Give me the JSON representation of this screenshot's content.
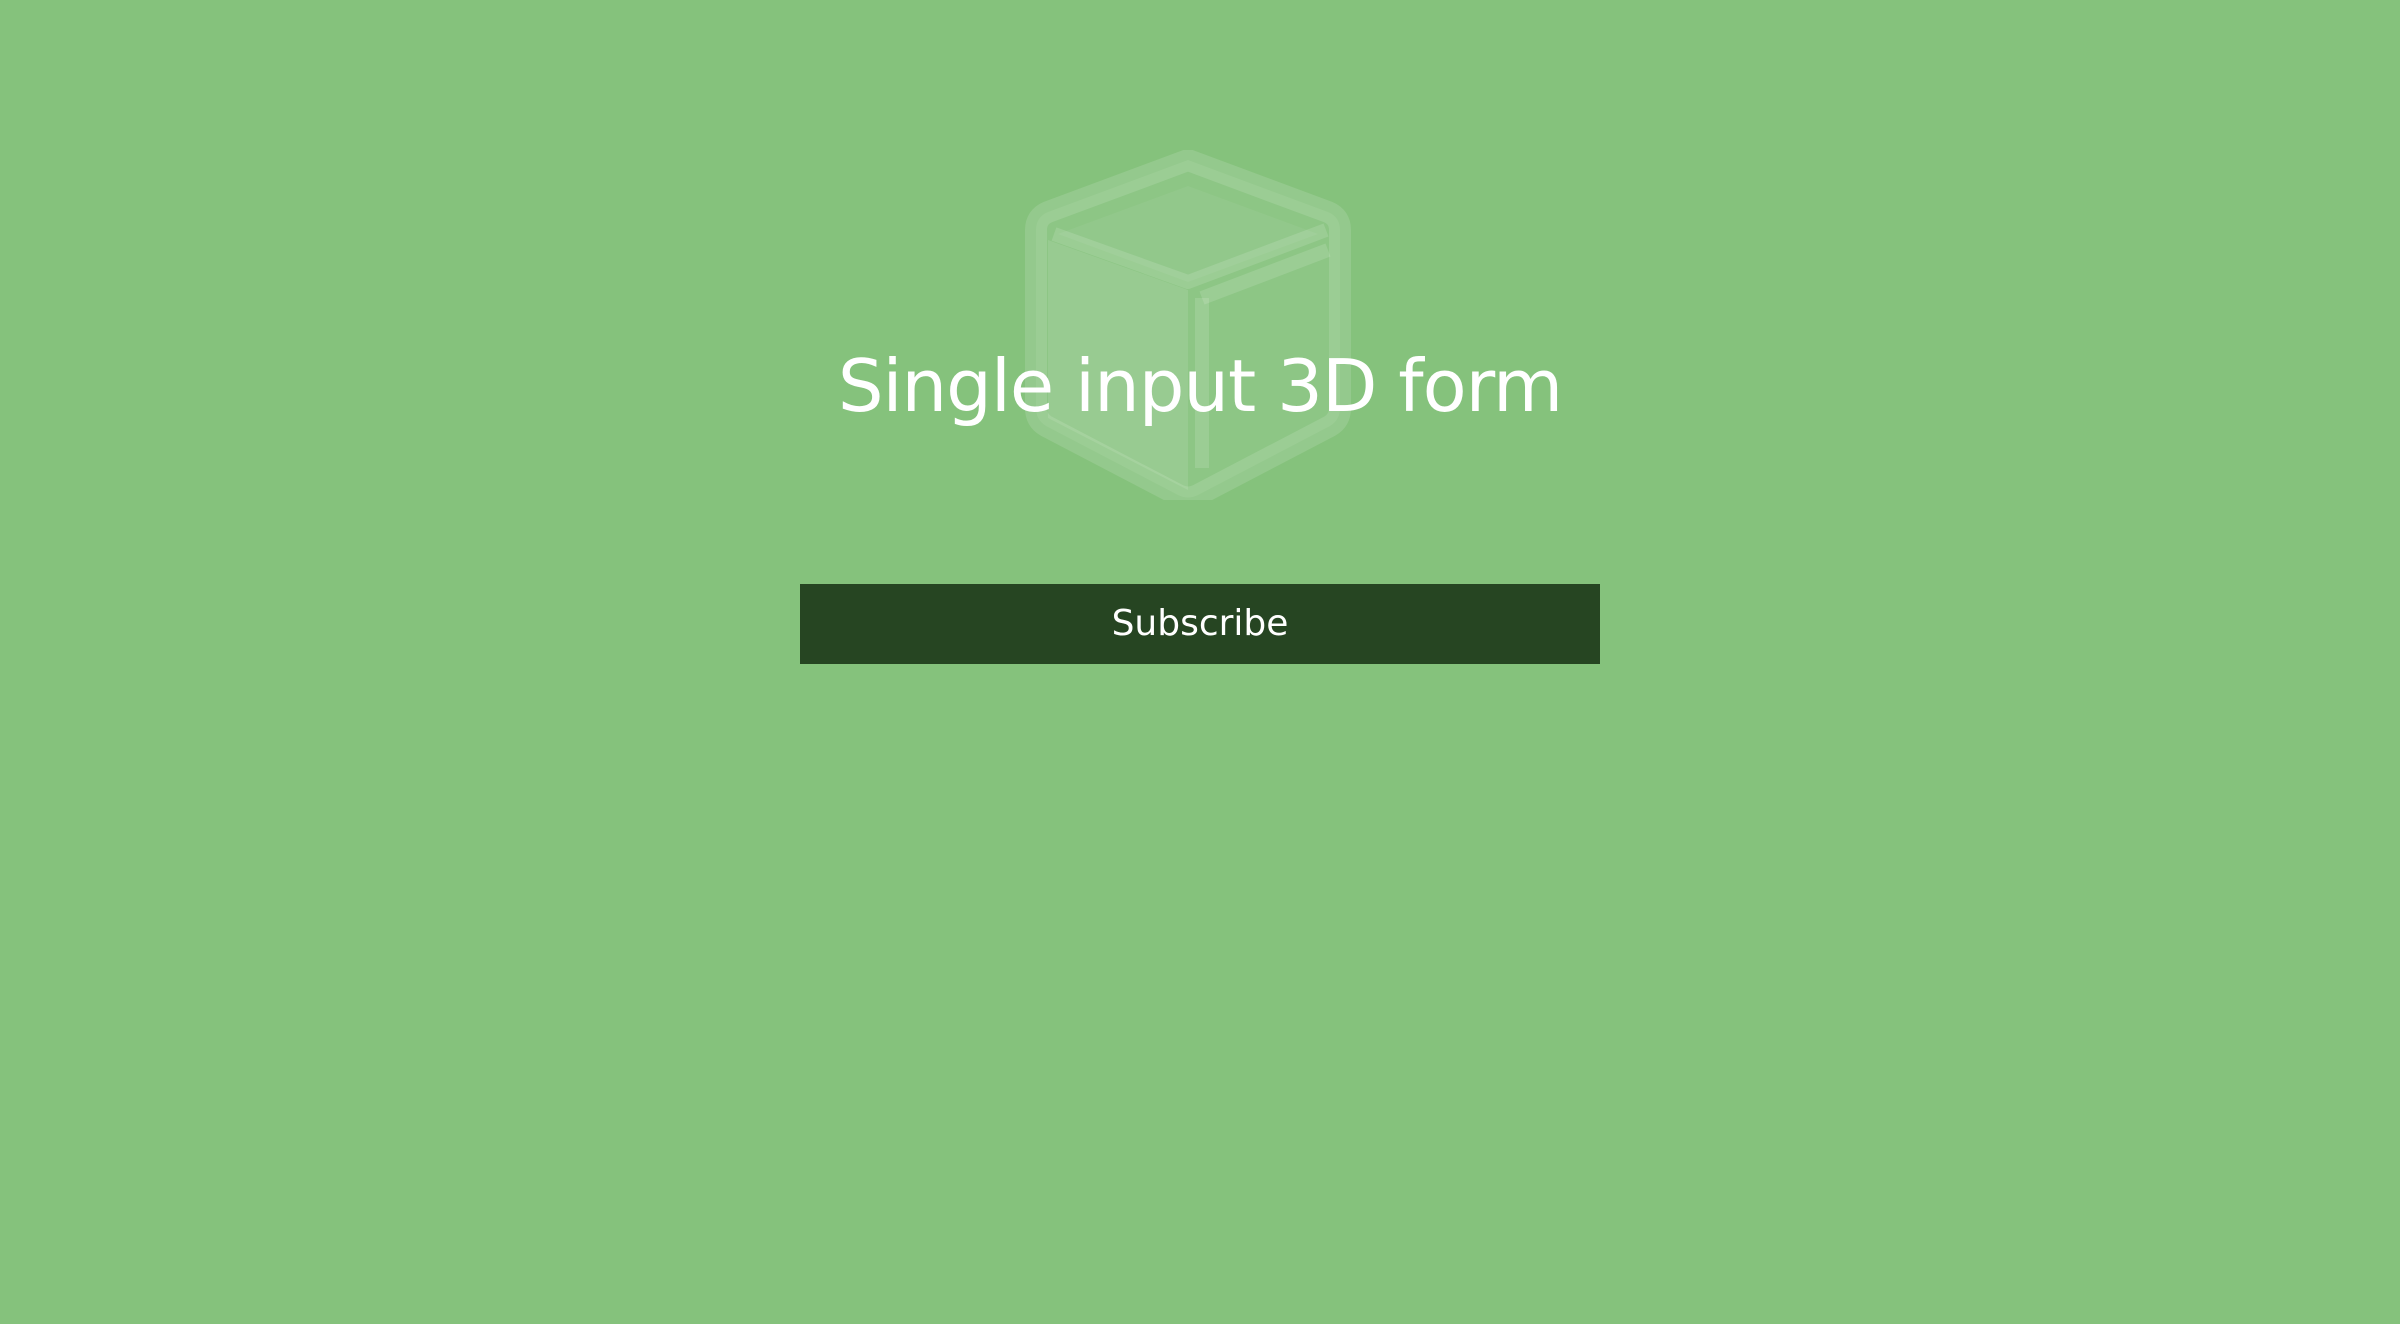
{
  "page": {
    "background_color": "#85c27c",
    "title": "Single input 3D form"
  },
  "background_icon": {
    "name": "cube-icon",
    "color": "#ffffff"
  },
  "form": {
    "button_label": "Subscribe",
    "button_color": "#264522",
    "button_text_color": "#ffffff"
  }
}
